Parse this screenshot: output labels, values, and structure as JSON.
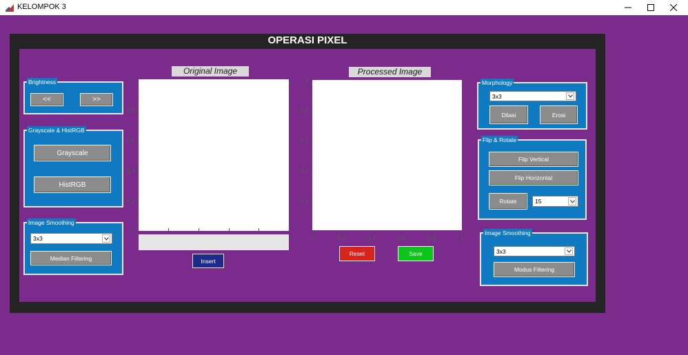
{
  "window": {
    "title": "KELOMPOK 3",
    "minimize_icon": "minimize-icon",
    "maximize_icon": "maximize-icon",
    "close_icon": "close-icon"
  },
  "main": {
    "title": "OPERASI PIXEL"
  },
  "brightness": {
    "label": "Brightness",
    "decrease_label": "<<",
    "increase_label": ">>"
  },
  "grayscale": {
    "label": "Grayscale & HistRGB",
    "grayscale_label": "Grayscale",
    "histrgb_label": "HistRGB"
  },
  "smoothing_left": {
    "label": "Image Smoothing",
    "kernel_value": "3x3",
    "button_label": "Median Filtering"
  },
  "original": {
    "title": "Original Image",
    "y_ticks": [
      "1",
      "0.8",
      "0.6",
      "0.4",
      "0.2",
      "0"
    ],
    "path_value": "",
    "insert_label": "Insert"
  },
  "processed": {
    "title": "Processed Image",
    "y_ticks": [
      "1",
      "0.8",
      "0.6",
      "0.4",
      "0.2"
    ],
    "x_ticks": [
      "0",
      "0.2",
      "0.4",
      "0.6",
      "0.8",
      "1"
    ],
    "reset_label": "Reset",
    "save_label": "Save"
  },
  "morphology": {
    "label": "Morphology",
    "kernel_value": "3x3",
    "dilasi_label": "Dilasi",
    "erosi_label": "Erosi"
  },
  "flip_rotate": {
    "label": "Flip & Rotate",
    "flip_vertical_label": "Flip Vertical",
    "flip_horizontal_label": "Flip Horizontal",
    "rotate_label": "Rotate",
    "angle_value": "15"
  },
  "smoothing_right": {
    "label": "Image Smoothing",
    "kernel_value": "3x3",
    "button_label": "Modus Filtering"
  },
  "colors": {
    "background": "#7a2b8b",
    "panel_frame": "#242424",
    "group_blue": "#0f7ac1",
    "button_gray": "#8c8c8c",
    "reset_red": "#d8241a",
    "save_green": "#0cc41c",
    "insert_navy": "#1d2a8a"
  }
}
